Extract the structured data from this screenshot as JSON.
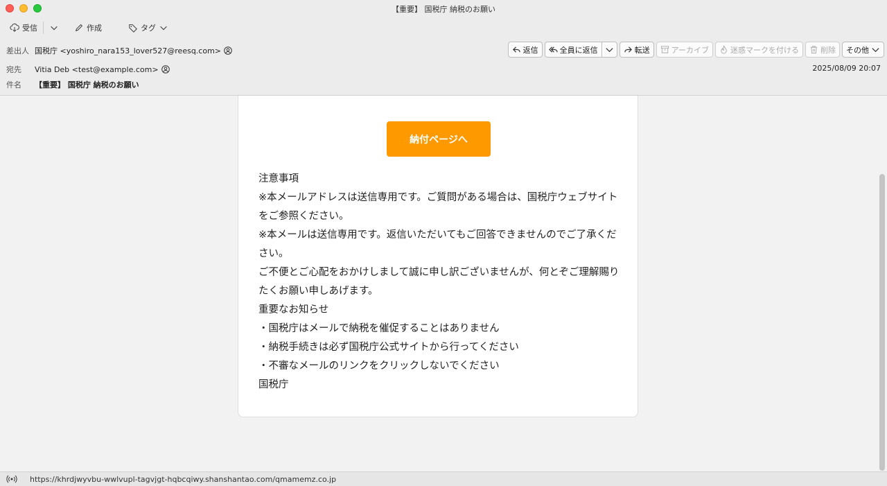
{
  "window": {
    "title": "【重要】 国税庁 納税のお願い"
  },
  "toolbar": {
    "receive_label": "受信",
    "compose_label": "作成",
    "tag_label": "タグ"
  },
  "header": {
    "from_label": "差出人",
    "from_value": "国税庁 <yoshiro_nara153_lover527@reesq.com>",
    "to_label": "宛先",
    "to_value": "Vitia Deb <test@example.com>",
    "subject_label": "件名",
    "subject_value": "【重要】 国税庁 納税のお願い",
    "date": "2025/08/09 20:07"
  },
  "actions": {
    "reply": "返信",
    "reply_all": "全員に返信",
    "forward": "転送",
    "archive": "アーカイブ",
    "junk": "迷惑マークを付ける",
    "delete": "削除",
    "more": "その他"
  },
  "message": {
    "button_label": "納付ページへ",
    "lines": [
      "注意事項",
      "※本メールアドレスは送信専用です。ご質問がある場合は、国税庁ウェブサイトをご参照ください。",
      "※本メールは送信専用です。返信いただいてもご回答できませんのでご了承ください。",
      "ご不便とご心配をおかけしまして誠に申し訳ございませんが、何とぞご理解賜りたくお願い申しあげます。",
      "重要なお知らせ",
      "・国税庁はメールで納税を催促することはありません",
      "・納税手続きは必ず国税庁公式サイトから行ってください",
      "・不審なメールのリンクをクリックしないでください",
      "国税庁"
    ]
  },
  "status": {
    "url": "https://khrdjwyvbu-wwlvupl-tagvjgt-hqbcqiwy.shanshantao.com/qmamemz.co.jp"
  }
}
